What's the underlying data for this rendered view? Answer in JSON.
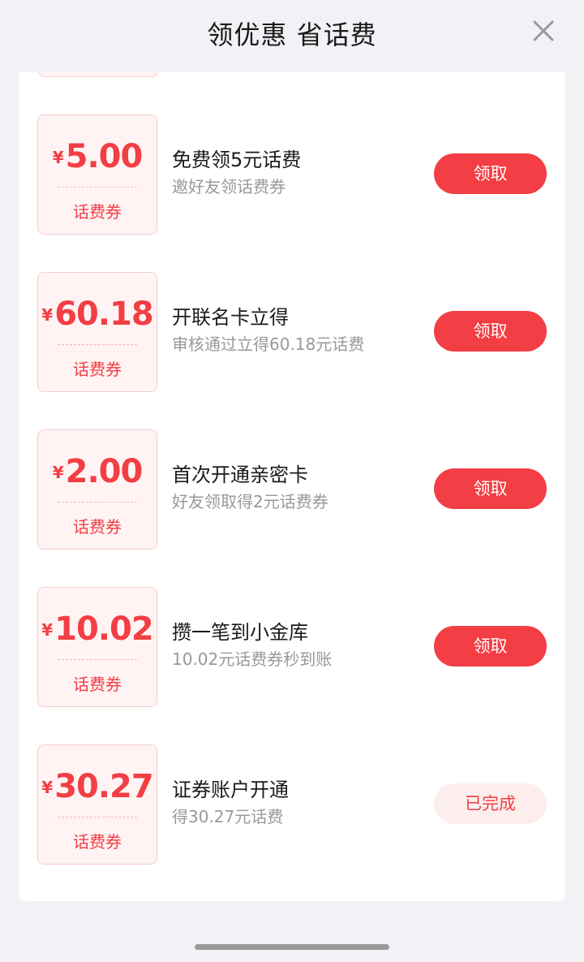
{
  "header": {
    "title": "领优惠 省话费",
    "close_icon": "close-icon"
  },
  "coupons": [
    {
      "currency": "¥",
      "amount": "5.00",
      "label": "话费券",
      "title": "免费领5元话费",
      "subtitle": "邀好友领话费券",
      "button": "领取",
      "status": "active"
    },
    {
      "currency": "¥",
      "amount": "60.18",
      "label": "话费券",
      "title": "开联名卡立得",
      "subtitle": "审核通过立得60.18元话费",
      "button": "领取",
      "status": "active"
    },
    {
      "currency": "¥",
      "amount": "2.00",
      "label": "话费券",
      "title": "首次开通亲密卡",
      "subtitle": "好友领取得2元话费券",
      "button": "领取",
      "status": "active"
    },
    {
      "currency": "¥",
      "amount": "10.02",
      "label": "话费券",
      "title": "攒一笔到小金库",
      "subtitle": "10.02元话费券秒到账",
      "button": "领取",
      "status": "active"
    },
    {
      "currency": "¥",
      "amount": "30.27",
      "label": "话费券",
      "title": "证券账户开通",
      "subtitle": "得30.27元话费",
      "button": "已完成",
      "status": "done"
    }
  ],
  "colors": {
    "accent": "#f23e44",
    "coupon_bg": "#fff4f3",
    "done_bg": "#fdeeee",
    "page_bg": "#f2f2f6"
  }
}
